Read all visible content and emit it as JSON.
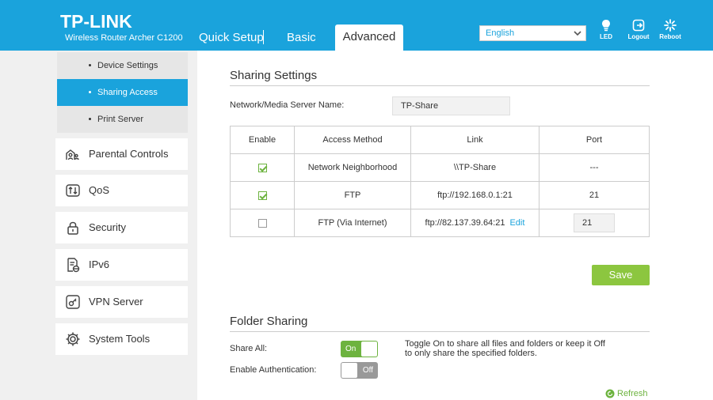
{
  "header": {
    "brand": "TP-LINK",
    "model": "Wireless Router Archer C1200",
    "tabs": [
      {
        "label": "Quick Setup"
      },
      {
        "label": "Basic"
      },
      {
        "label": "Advanced"
      }
    ],
    "language": "English",
    "buttons": [
      {
        "label": "LED",
        "icon": "bulb-icon"
      },
      {
        "label": "Logout",
        "icon": "logout-icon"
      },
      {
        "label": "Reboot",
        "icon": "reboot-icon"
      }
    ],
    "accent_color": "#1aa3dc"
  },
  "sidebar": {
    "sub_items": [
      {
        "label": "Device Settings"
      },
      {
        "label": "Sharing Access",
        "active": true
      },
      {
        "label": "Print Server"
      }
    ],
    "items": [
      {
        "label": "Parental Controls",
        "icon": "parental-controls-icon"
      },
      {
        "label": "QoS",
        "icon": "qos-icon"
      },
      {
        "label": "Security",
        "icon": "lock-icon"
      },
      {
        "label": "IPv6",
        "icon": "ipv6-icon"
      },
      {
        "label": "VPN Server",
        "icon": "vpn-icon"
      },
      {
        "label": "System Tools",
        "icon": "gear-icon"
      }
    ]
  },
  "sharing": {
    "title": "Sharing Settings",
    "server_name_label": "Network/Media Server Name:",
    "server_name_value": "TP-Share",
    "table": {
      "headers": [
        "Enable",
        "Access Method",
        "Link",
        "Port"
      ],
      "rows": [
        {
          "enabled": true,
          "method": "Network Neighborhood",
          "link": "\\\\TP-Share",
          "port": "---"
        },
        {
          "enabled": true,
          "method": "FTP",
          "link": "ftp://192.168.0.1:21",
          "port": "21"
        },
        {
          "enabled": false,
          "method": "FTP (Via Internet)",
          "link": "ftp://82.137.39.64:21",
          "edit": "Edit",
          "port": "21"
        }
      ]
    },
    "save_label": "Save"
  },
  "folder_sharing": {
    "title": "Folder Sharing",
    "share_all_label": "Share All:",
    "share_all_state": "On",
    "auth_label": "Enable Authentication:",
    "auth_state": "Off",
    "hint": "Toggle On to share all files and folders or keep it Off to only share the specified folders.",
    "refresh_label": "Refresh"
  },
  "colors": {
    "accent": "#1aa3dc",
    "green": "#8cc63f",
    "toggle_on": "#6db33f",
    "toggle_off": "#999999"
  }
}
